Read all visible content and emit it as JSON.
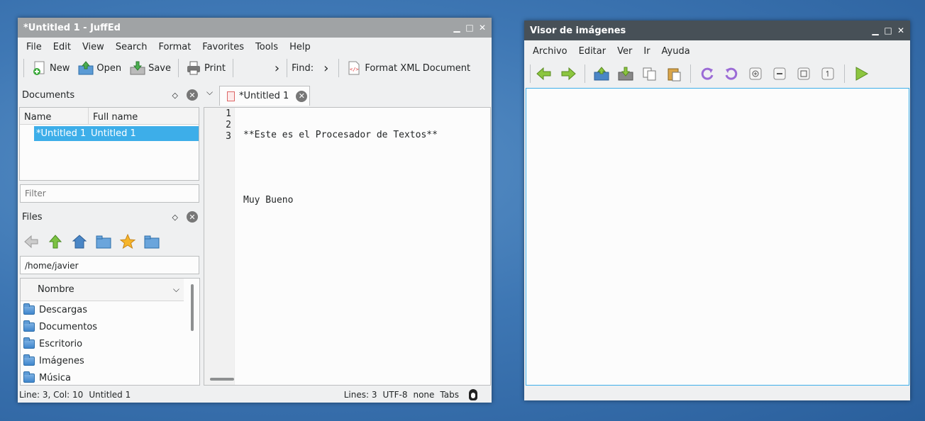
{
  "juffed": {
    "title": "*Untitled 1 - JuffEd",
    "menu": [
      "File",
      "Edit",
      "View",
      "Search",
      "Format",
      "Favorites",
      "Tools",
      "Help"
    ],
    "toolbar": {
      "new": "New",
      "open": "Open",
      "save": "Save",
      "print": "Print",
      "find": "Find:",
      "format_xml": "Format XML Document"
    },
    "documents": {
      "title": "Documents",
      "col_name": "Name",
      "col_full": "Full name",
      "row_name": "*Untitled 1",
      "row_full": "Untitled 1",
      "filter_placeholder": "Filter"
    },
    "files": {
      "title": "Files",
      "path": "/home/javier",
      "col": "Nombre",
      "items": [
        "Descargas",
        "Documentos",
        "Escritorio",
        "Imágenes",
        "Música"
      ]
    },
    "tab": "*Untitled 1",
    "editor": {
      "line_numbers": [
        "1",
        "2",
        "3"
      ],
      "lines": [
        "**Este es el Procesador de Textos**",
        "",
        "Muy Bueno"
      ]
    },
    "status": {
      "pos": "Line: 3, Col: 10",
      "file": "Untitled 1",
      "lines": "Lines: 3",
      "enc": "UTF-8",
      "eol": "none",
      "indent": "Tabs"
    }
  },
  "visor": {
    "title": "Visor de imágenes",
    "menu": [
      "Archivo",
      "Editar",
      "Ver",
      "Ir",
      "Ayuda"
    ]
  }
}
